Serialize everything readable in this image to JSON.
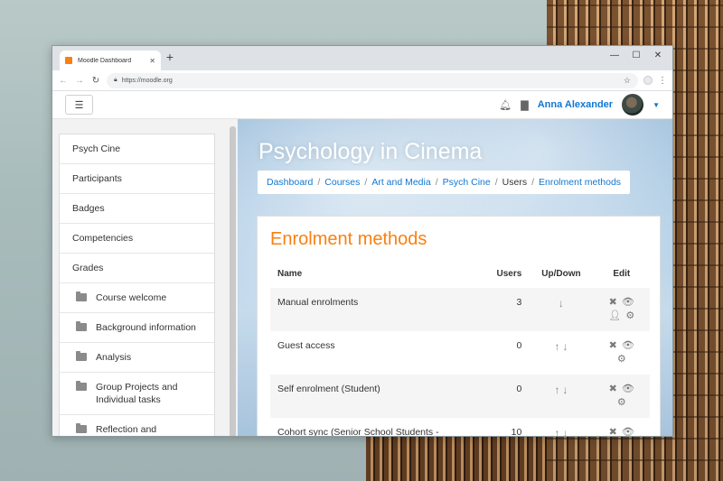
{
  "browser": {
    "tab_title": "Moodle Dashboard",
    "tab_close": "✕",
    "new_tab": "+",
    "url": "https://moodle.org",
    "win_min": "—",
    "win_max": "☐",
    "win_close": "✕"
  },
  "navbar": {
    "menu_icon": "☰",
    "user_name": "Anna Alexander"
  },
  "drawer": {
    "items": [
      {
        "label": "Psych Cine"
      },
      {
        "label": "Participants"
      },
      {
        "label": "Badges"
      },
      {
        "label": "Competencies"
      },
      {
        "label": "Grades"
      }
    ],
    "sections": [
      {
        "label": "Course welcome"
      },
      {
        "label": "Background information"
      },
      {
        "label": "Analysis"
      },
      {
        "label": "Group Projects and Individual tasks"
      },
      {
        "label": "Reflection and"
      }
    ]
  },
  "main": {
    "course_title": "Psychology in Cinema",
    "breadcrumb": [
      {
        "label": "Dashboard"
      },
      {
        "label": "Courses"
      },
      {
        "label": "Art and Media"
      },
      {
        "label": "Psych Cine"
      },
      {
        "label": "Users"
      },
      {
        "label": "Enrolment methods"
      }
    ],
    "card_title": "Enrolment methods",
    "table": {
      "headers": {
        "name": "Name",
        "users": "Users",
        "updown": "Up/Down",
        "edit": "Edit"
      },
      "rows": [
        {
          "name": "Manual enrolments",
          "users": "3"
        },
        {
          "name": "Guest access",
          "users": "0"
        },
        {
          "name": "Self enrolment (Student)",
          "users": "0"
        },
        {
          "name": "Cohort sync (Senior School Students -",
          "users": "10"
        }
      ]
    }
  },
  "colors": {
    "accent_orange": "#f98012",
    "link_blue": "#1177d1"
  }
}
